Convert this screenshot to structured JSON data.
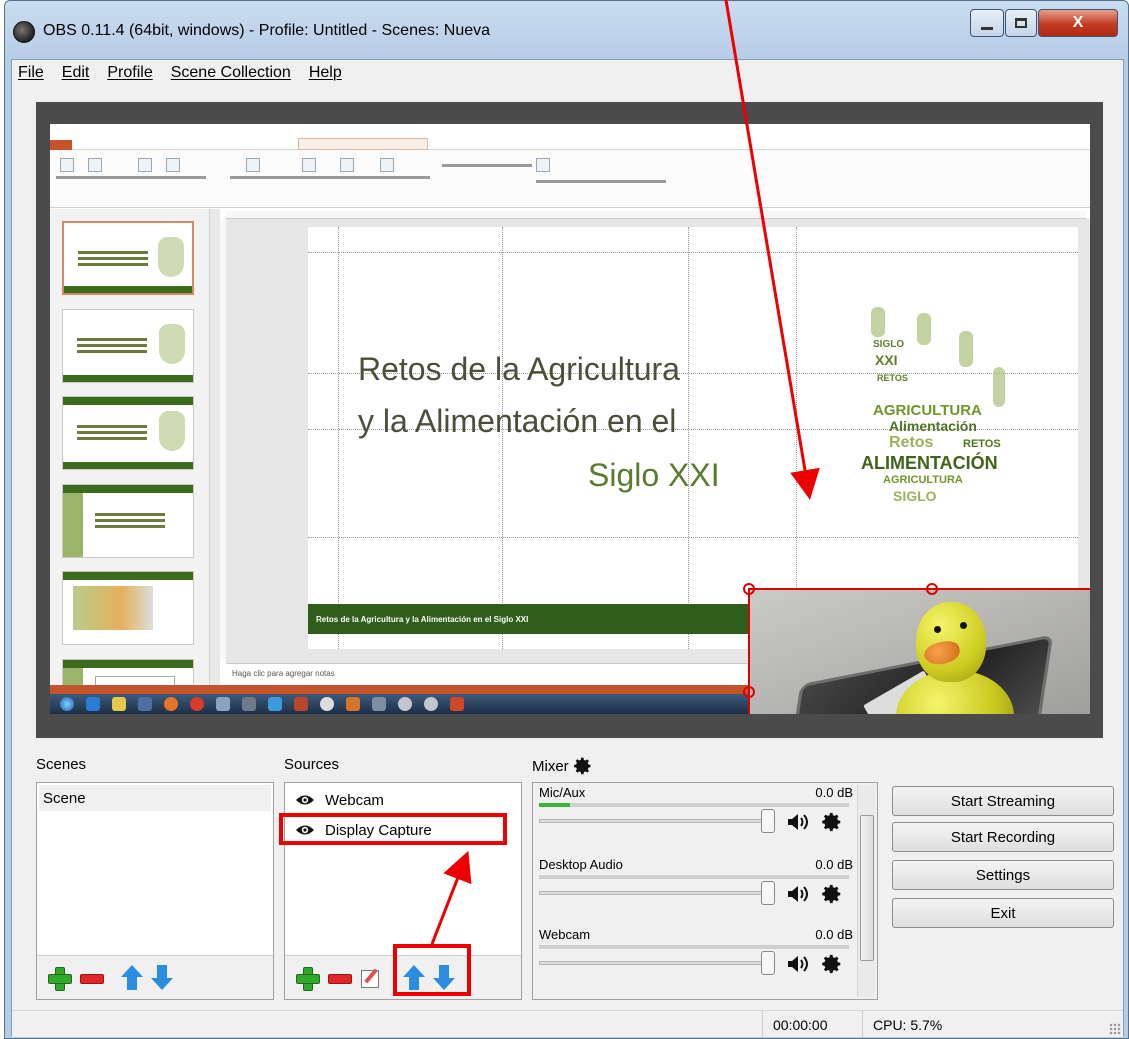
{
  "window": {
    "title": "OBS 0.11.4 (64bit, windows) - Profile: Untitled - Scenes: Nueva",
    "close_glyph": "X"
  },
  "menu": {
    "items": [
      "File",
      "Edit",
      "Profile",
      "Scene Collection",
      "Help"
    ]
  },
  "preview": {
    "slide": {
      "title_line1": "Retos de la Agricultura",
      "title_line2": "y la Alimentación en el",
      "title_line3": "Siglo XXI",
      "footer": "Retos de la Agricultura y la Alimentación en el Siglo XXI",
      "word_cloud": [
        "SIGLO",
        "XXI",
        "RETOS",
        "AGRICULTURA",
        "Alimentación",
        "Retos",
        "RETOS",
        "ALIMENTACIÓN",
        "AGRICULTURA",
        "SIGLO"
      ]
    },
    "notes_placeholder": "Haga clic para agregar notas"
  },
  "scenes": {
    "label": "Scenes",
    "items": [
      "Scene"
    ]
  },
  "sources": {
    "label": "Sources",
    "items": [
      "Webcam",
      "Display Capture"
    ]
  },
  "mixer": {
    "label": "Mixer",
    "channels": [
      {
        "name": "Mic/Aux",
        "db": "0.0 dB",
        "level": 0.1
      },
      {
        "name": "Desktop Audio",
        "db": "0.0 dB",
        "level": 0
      },
      {
        "name": "Webcam",
        "db": "0.0 dB",
        "level": 0
      }
    ]
  },
  "controls": {
    "start_streaming": "Start Streaming",
    "start_recording": "Start Recording",
    "settings": "Settings",
    "exit": "Exit"
  },
  "status": {
    "time": "00:00:00",
    "cpu": "CPU: 5.7%"
  },
  "colors": {
    "annotation": "#ee0000",
    "selection": "#e00000",
    "slide_green": "#2f5d1a"
  }
}
